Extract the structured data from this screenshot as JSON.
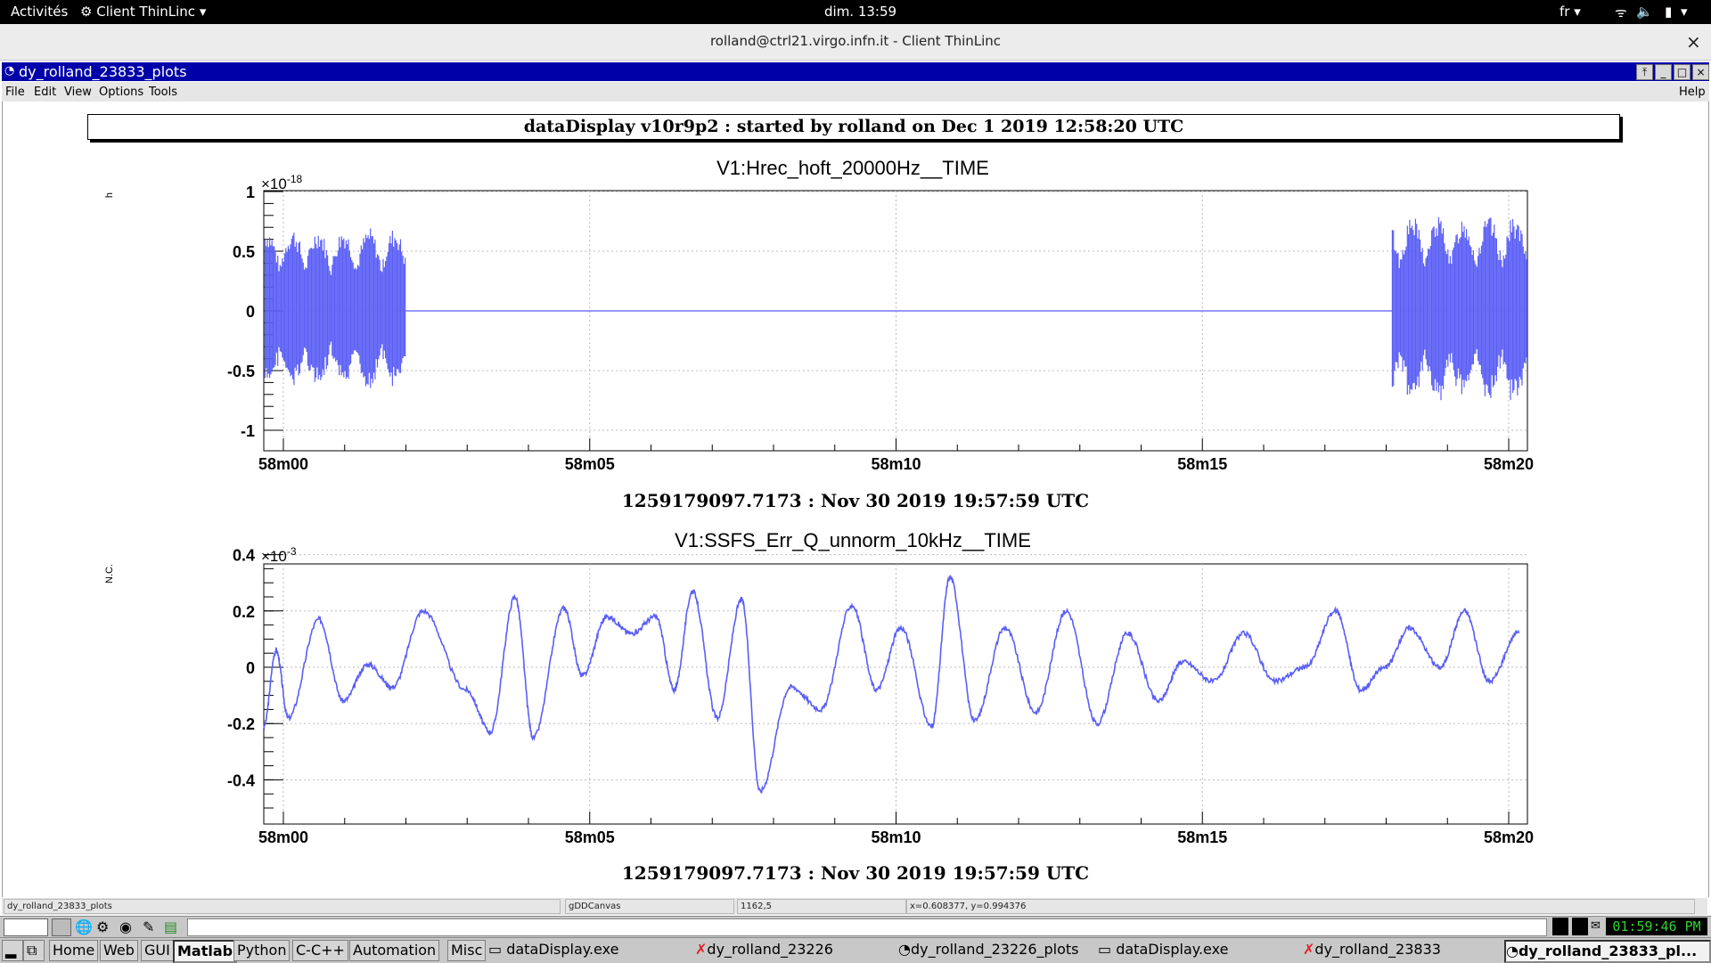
{
  "system_bar": {
    "activities": "Activités",
    "app_menu": "Client ThinLinc",
    "clock": "dim. 13:59",
    "language": "fr"
  },
  "thinlinc": {
    "title": "rolland@ctrl21.virgo.infn.it - Client ThinLinc",
    "close": "×"
  },
  "window": {
    "title": "dy_rolland_23833_plots",
    "menu": [
      "File",
      "Edit",
      "View",
      "Options",
      "Tools"
    ],
    "help": "Help"
  },
  "header": "dataDisplay v10r9p2 : started by rolland on Dec  1 2019 12:58:20 UTC",
  "plots": [
    {
      "title": "V1:Hrec_hoft_20000Hz__TIME",
      "ylabel": "h",
      "exponent_base": "×10",
      "exponent": "-18",
      "yticks": [
        "1",
        "0.5",
        "0",
        "-0.5",
        "-1"
      ],
      "xticks": [
        "58m00",
        "58m05",
        "58m10",
        "58m15",
        "58m20"
      ],
      "time_label": "1259179097.7173 : Nov 30 2019 19:57:59 UTC"
    },
    {
      "title": "V1:SSFS_Err_Q_unnorm_10kHz__TIME",
      "ylabel": "N.C.",
      "exponent_base": "×10",
      "exponent": "-3",
      "yticks": [
        "0.4",
        "0.2",
        "0",
        "-0.2",
        "-0.4"
      ],
      "xticks": [
        "58m00",
        "58m05",
        "58m10",
        "58m15",
        "58m20"
      ],
      "time_label": "1259179097.7173 : Nov 30 2019 19:57:59 UTC"
    }
  ],
  "chart_data": [
    {
      "type": "line",
      "title": "V1:Hrec_hoft_20000Hz__TIME",
      "ylabel": "h",
      "y_scale": "×10^-18",
      "ylim": [
        -1,
        1
      ],
      "xlim_minutes": [
        0,
        20.5
      ],
      "grid": true,
      "segments": [
        {
          "x_start": 0,
          "x_end": 2.0,
          "amplitude": 0.7,
          "description_of_signal": "oscillating"
        },
        {
          "x_start": 2.0,
          "x_end": 18.1,
          "amplitude": 0.0
        },
        {
          "x_start": 18.1,
          "x_end": 20.5,
          "amplitude": 0.8
        }
      ]
    },
    {
      "type": "line",
      "title": "V1:SSFS_Err_Q_unnorm_10kHz__TIME",
      "ylabel": "N.C.",
      "y_scale": "×10^-3",
      "ylim": [
        -0.5,
        0.4
      ],
      "grid": true,
      "x": [
        0,
        0.2,
        0.4,
        0.9,
        1.3,
        1.7,
        2.1,
        2.6,
        3.3,
        3.7,
        4.1,
        4.4,
        4.9,
        5.2,
        5.6,
        6.0,
        6.4,
        6.7,
        7.0,
        7.4,
        7.8,
        8.1,
        8.6,
        9.1,
        9.6,
        10.0,
        10.4,
        10.9,
        11.2,
        11.6,
        12.1,
        12.6,
        13.1,
        13.6,
        14.1,
        14.6,
        15.0,
        15.5,
        16.0,
        16.5,
        17.0,
        17.5,
        17.9,
        18.3,
        18.7,
        19.2,
        19.6,
        20.0,
        20.5
      ],
      "y": [
        -0.21,
        0.06,
        -0.18,
        0.17,
        -0.12,
        0.01,
        -0.07,
        0.2,
        -0.08,
        -0.23,
        0.25,
        -0.25,
        0.21,
        -0.03,
        0.18,
        0.12,
        0.18,
        -0.08,
        0.27,
        -0.18,
        0.24,
        -0.44,
        -0.07,
        -0.15,
        0.22,
        -0.08,
        0.14,
        -0.21,
        0.32,
        -0.19,
        0.14,
        -0.16,
        0.2,
        -0.2,
        0.12,
        -0.12,
        0.02,
        -0.05,
        0.12,
        -0.05,
        0.0,
        0.2,
        -0.08,
        0.0,
        0.14,
        0.0,
        0.2,
        -0.05,
        0.13
      ]
    }
  ],
  "statusbar": {
    "name": "dy_rolland_23833_plots",
    "canvas": "gDDCanvas",
    "pos": "1162,5",
    "coords": "x=0.608377, y=0.994376"
  },
  "iconbar": {
    "clock": "01:59:46 PM"
  },
  "taskbar": {
    "buttons": [
      "Home",
      "Web",
      "GUI",
      "Matlab",
      "Python",
      "C-C++",
      "Automation",
      "Misc"
    ],
    "tasks": [
      "dataDisplay.exe",
      "dy_rolland_23226",
      "dy_rolland_23226_plots",
      "dataDisplay.exe",
      "dy_rolland_23833",
      "dy_rolland_23833_pl..."
    ]
  }
}
